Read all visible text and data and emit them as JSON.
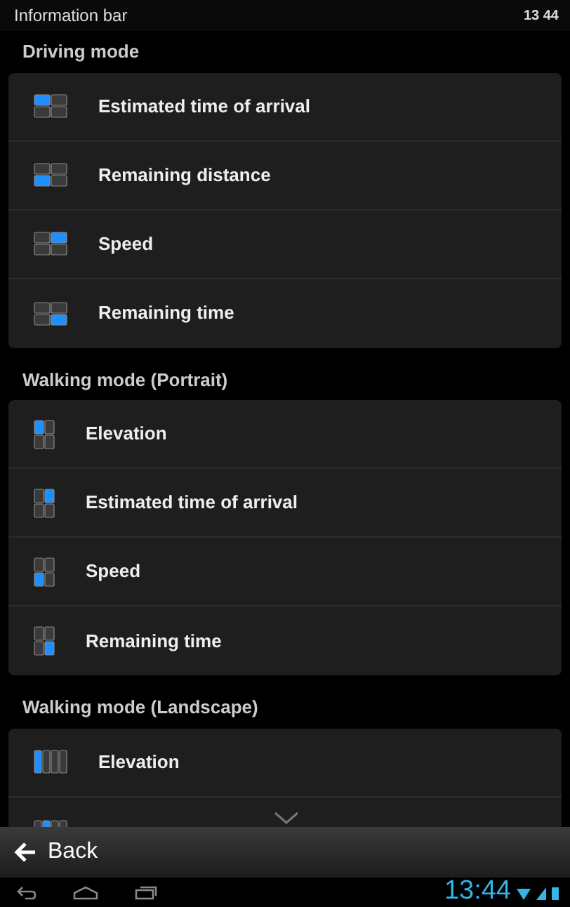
{
  "title_bar": {
    "title": "Information bar",
    "time": "13 44"
  },
  "sections": [
    {
      "title": "Driving mode",
      "kind": "landscape",
      "items": [
        {
          "label": "Estimated time of arrival",
          "kind": "topleft"
        },
        {
          "label": "Remaining distance",
          "kind": "bottomleft"
        },
        {
          "label": "Speed",
          "kind": "topright"
        },
        {
          "label": "Remaining time",
          "kind": "bottomright"
        }
      ]
    },
    {
      "title": "Walking mode (Portrait)",
      "kind": "portrait",
      "items": [
        {
          "label": "Elevation",
          "kind": "topleft"
        },
        {
          "label": "Estimated time of arrival",
          "kind": "topright"
        },
        {
          "label": "Speed",
          "kind": "bottomleft"
        },
        {
          "label": "Remaining time",
          "kind": "bottomright"
        }
      ]
    },
    {
      "title": "Walking mode (Landscape)",
      "kind": "columns",
      "items": [
        {
          "label": "Elevation",
          "kind": "first"
        },
        {
          "kind": "second"
        }
      ]
    }
  ],
  "action_bar": {
    "back": "Back"
  },
  "nav_bar": {
    "clock": "13:44"
  }
}
